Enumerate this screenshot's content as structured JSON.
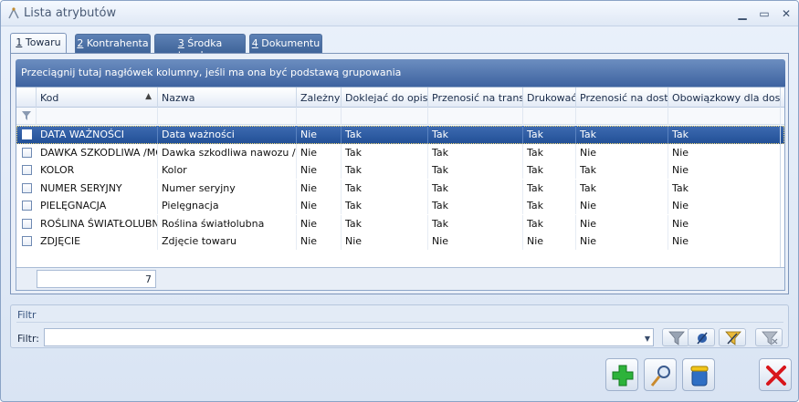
{
  "window": {
    "title": "Lista atrybutów"
  },
  "tabs": [
    {
      "key": "1",
      "label": " Towaru"
    },
    {
      "key": "2",
      "label": " Kontrahenta"
    },
    {
      "key": "3",
      "label": " Środka trwałego"
    },
    {
      "key": "4",
      "label": " Dokumentu"
    }
  ],
  "group_bar": "Przeciągnij tutaj nagłówek kolumny, jeśli ma ona być podstawą grupowania",
  "columns": [
    "Kod",
    "Nazwa",
    "Zależny",
    "Doklejać do opisu",
    "Przenosić na trans.",
    "Drukować",
    "Przenosić na dost.",
    "Obowiązkowy dla dost."
  ],
  "rows": [
    [
      "DATA WAŻNOŚCI",
      "Data ważności",
      "Nie",
      "Tak",
      "Tak",
      "Tak",
      "Tak",
      "Tak"
    ],
    [
      "DAWKA SZKODLIWA /MG/",
      "Dawka szkodliwa nawozu /mg/",
      "Nie",
      "Tak",
      "Tak",
      "Tak",
      "Nie",
      "Nie"
    ],
    [
      "KOLOR",
      "Kolor",
      "Nie",
      "Tak",
      "Tak",
      "Tak",
      "Tak",
      "Nie"
    ],
    [
      "NUMER SERYJNY",
      "Numer seryjny",
      "Nie",
      "Tak",
      "Tak",
      "Tak",
      "Tak",
      "Tak"
    ],
    [
      "PIELĘGNACJA",
      "Pielęgnacja",
      "Nie",
      "Tak",
      "Tak",
      "Tak",
      "Nie",
      "Nie"
    ],
    [
      "ROŚLINA ŚWIATŁOLUBNA",
      "Roślina światłolubna",
      "Nie",
      "Tak",
      "Tak",
      "Tak",
      "Nie",
      "Nie"
    ],
    [
      "ZDJĘCIE",
      "Zdjęcie towaru",
      "Nie",
      "Nie",
      "Nie",
      "Nie",
      "Nie",
      "Nie"
    ]
  ],
  "footer_count": "7",
  "filter": {
    "title": "Filtr",
    "label": "Filtr:",
    "value": ""
  },
  "colors": {
    "accent": "#3f6499",
    "selected_row": "#2a5aa0",
    "add_button": "#2db33b",
    "close_button": "#d8161b"
  }
}
